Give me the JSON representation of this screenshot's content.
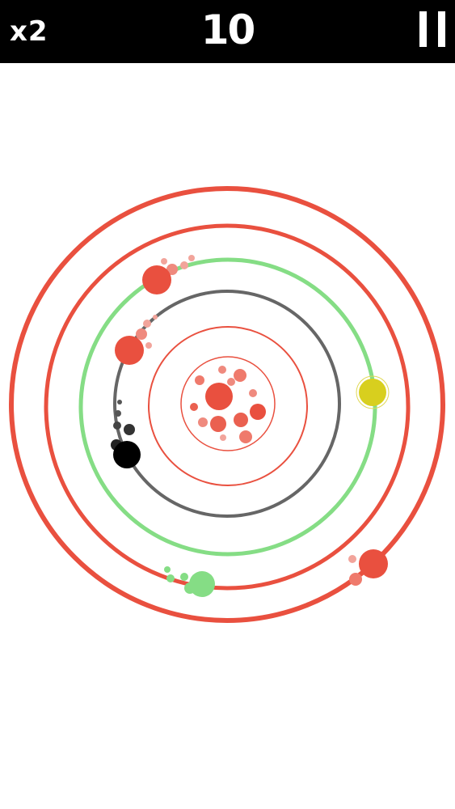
{
  "hud": {
    "multiplier": "x2",
    "score": "10",
    "pause_icon": "pause-icon"
  },
  "colors": {
    "hud_background": "#000000",
    "hud_text": "#ffffff",
    "red": "#e9503f",
    "green": "#85dd85",
    "gray": "#666666",
    "black": "#000000",
    "yellow": "#d8cf1e"
  }
}
